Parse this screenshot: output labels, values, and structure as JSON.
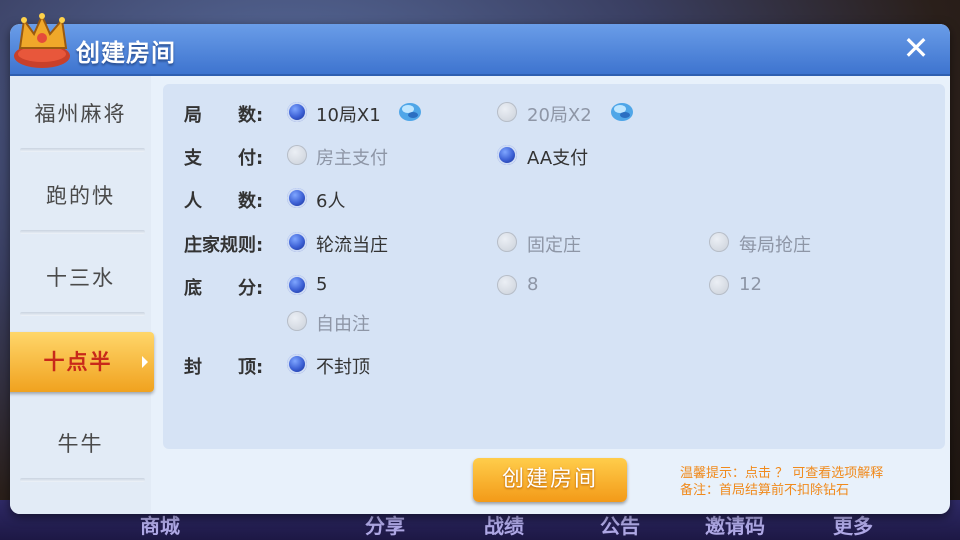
{
  "dialog": {
    "title": "创建房间"
  },
  "tabs": [
    {
      "label": "福州麻将"
    },
    {
      "label": "跑的快"
    },
    {
      "label": "十三水"
    },
    {
      "label": "十点半"
    },
    {
      "label": "牛牛"
    }
  ],
  "active_tab": 3,
  "form": {
    "rounds": {
      "label": "局　　数:",
      "options": [
        "10局X1",
        "20局X2"
      ],
      "selected": 0
    },
    "payment": {
      "label": "支　　付:",
      "options": [
        "房主支付",
        "AA支付"
      ],
      "selected": 1
    },
    "players": {
      "label": "人　　数:",
      "options": [
        "6人"
      ],
      "selected": 0
    },
    "banker": {
      "label": "庄家规则:",
      "options": [
        "轮流当庄",
        "固定庄",
        "每局抢庄"
      ],
      "selected": 0
    },
    "base": {
      "label": "底　　分:",
      "options": [
        "5",
        "8",
        "12",
        "自由注"
      ],
      "selected": 0
    },
    "cap": {
      "label": "封　　顶:",
      "options": [
        "不封顶"
      ],
      "selected": 0
    }
  },
  "create_button": "创建房间",
  "hints": {
    "line1": "温馨提示：点击 ？ 可查看选项解释",
    "line2": "备注：首局结算前不扣除钻石"
  },
  "bottom_nav": [
    "商城",
    "分享",
    "战绩",
    "公告",
    "邀请码",
    "更多"
  ],
  "colors": {
    "title_bar": "#4a82d8",
    "active_tab": "#f5b331",
    "accent_orange": "#f08a1c",
    "radio_on": "#3e62d6"
  },
  "icons": {
    "close": "close-icon",
    "crown": "crown-icon",
    "gem": "diamond-icon"
  }
}
